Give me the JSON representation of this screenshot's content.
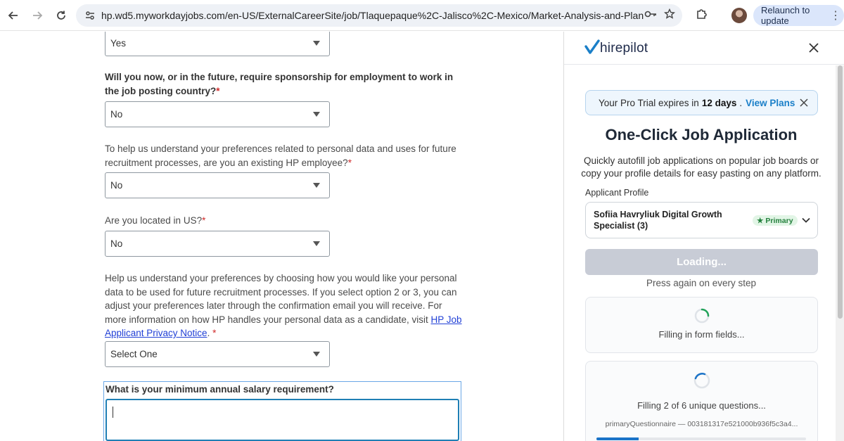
{
  "browser": {
    "url": "hp.wd5.myworkdayjobs.com/en-US/ExternalCareerSite/job/Tlaquepaque%2C-Jalisco%2C-Mexico/Market-Analysis-and-Planning-...",
    "relaunch_label": "Relaunch to update"
  },
  "form": {
    "first_select_value": "Yes",
    "q_sponsorship": "Will you now, or in the future, require sponsorship for employment to work in the job posting country?",
    "sponsorship_value": "No",
    "q_existing_employee": "To help us understand your preferences related to personal data and uses for future recruitment processes, are you an existing HP employee?",
    "existing_employee_value": "No",
    "q_located_us": "Are you located in US?",
    "located_us_value": "No",
    "q_preferences": "Help us understand your preferences by choosing how you would like your personal data to be used for future recruitment processes. If you select option 2 or 3, you can adjust your preferences later through the confirmation email you will receive. For more information on how HP handles your personal data as a candidate, visit",
    "privacy_link": "HP Job Applicant Privacy Notice",
    "preferences_trailing": ".",
    "preferences_value": "Select One",
    "q_salary": "What is your minimum annual salary requirement?",
    "salary_value": "",
    "required_mark": "*"
  },
  "panel": {
    "logo": "hirepilot",
    "trial": {
      "prefix": "Your Pro Trial expires in",
      "days": "12 days",
      "suffix": ".",
      "link": "View Plans"
    },
    "title": "One-Click Job Application",
    "subtitle": "Quickly autofill job applications on popular job boards or copy your profile details for easy pasting on any platform.",
    "profile_label": "Applicant Profile",
    "profile_name": "Sofiia Havryliuk Digital Growth Specialist (3)",
    "profile_badge": "Primary",
    "loading_label": "Loading...",
    "hint": "Press again on every step",
    "card1_text": "Filling in form fields...",
    "card2_text": "Filling 2 of 6 unique questions...",
    "card2_id": "primaryQuestionnaire — 003181317e521000b936f5c3a4...",
    "progress": 0.2,
    "accent_color": "#1a7fc8"
  }
}
